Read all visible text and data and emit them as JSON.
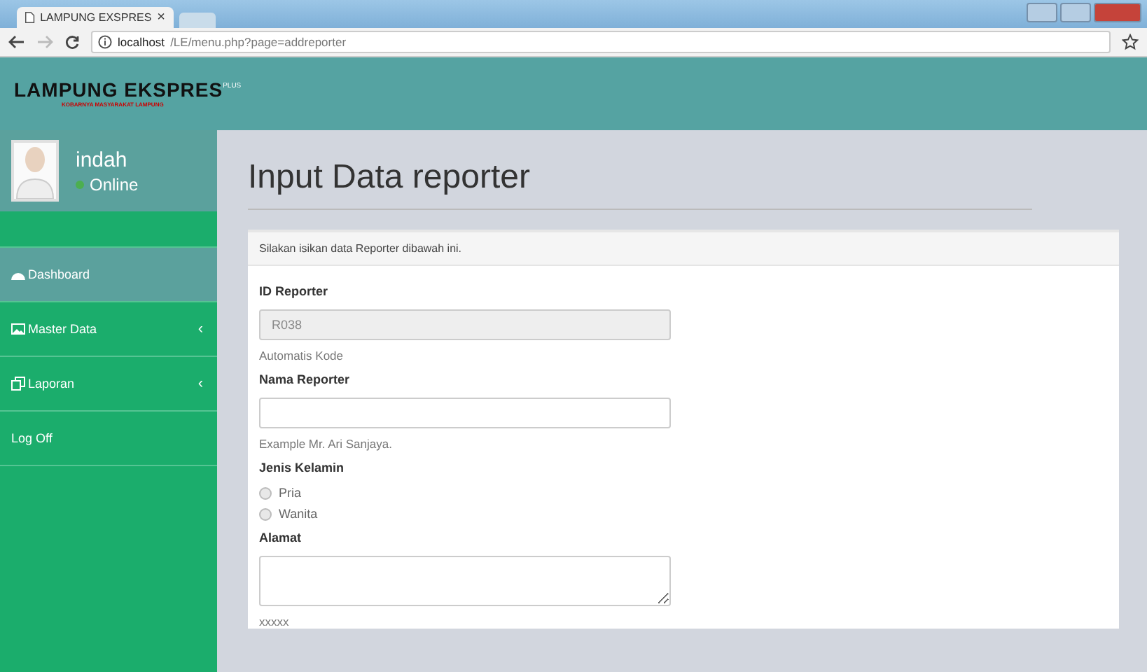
{
  "browser": {
    "tab_title": "LAMPUNG EXSPRES",
    "tab_close": "×",
    "url_host": "localhost",
    "url_path": "/LE/menu.php?page=addreporter"
  },
  "header": {
    "logo": "LAMPUNG EKSPRES",
    "logo_sup": "PLUS",
    "logo_tagline": "KOBARNYA MASYARAKAT LAMPUNG"
  },
  "user": {
    "name": "indah",
    "status": "Online",
    "online": true
  },
  "menu": [
    {
      "label": "Dashboard",
      "selected": true
    },
    {
      "label": "Master Data",
      "selected": false,
      "caret": "‹"
    },
    {
      "label": "Laporan",
      "selected": false,
      "caret": "‹"
    },
    {
      "label": "Log Off",
      "selected": false
    }
  ],
  "page_title": "Input Data reporter",
  "card": {
    "intro": "Silakan isikan data Reporter dibawah ini.",
    "fields": [
      {
        "kind": "text",
        "label": "ID Reporter",
        "value": "R038",
        "disabled": true,
        "help": "Automatis Kode"
      },
      {
        "kind": "text",
        "label": "Nama Reporter",
        "disabled": false,
        "help": "Example Mr. Ari Sanjaya."
      },
      {
        "kind": "radio",
        "label": "Jenis Kelamin",
        "options": [
          {
            "label": "Pria",
            "selected": false
          },
          {
            "label": "Wanita",
            "selected": false
          }
        ]
      },
      {
        "kind": "textarea",
        "label": "Alamat",
        "help": "xxxxx"
      }
    ]
  }
}
